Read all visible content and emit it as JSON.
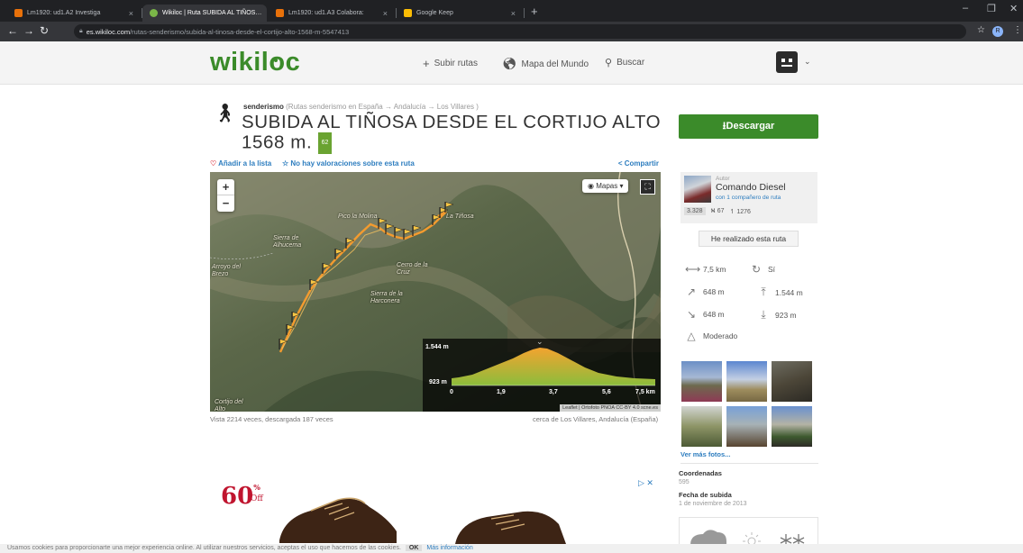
{
  "browser": {
    "tabs": [
      {
        "label": "Lm1920: ud1.A2 Investiga",
        "active": false
      },
      {
        "label": "Wikiloc | Ruta SUBIDA AL TIÑOS…",
        "active": true
      },
      {
        "label": "Lm1920: ud1.A3 Colabora:",
        "active": false
      },
      {
        "label": "Google Keep",
        "active": false
      }
    ],
    "new_tab": "+",
    "url_host": "es.wikiloc.com",
    "url_path": "/rutas-senderismo/subida-al-tinosa-desde-el-cortijo-alto-1568-m-5547413",
    "profile_initial": "R"
  },
  "header": {
    "logo": "wikiloc",
    "upload_label": "Subir rutas",
    "map_label": "Mapa del Mundo",
    "search_label": "Buscar"
  },
  "trail": {
    "activity": "senderismo",
    "breadcrumb": "(Rutas senderismo en España → Andalucía → Los Villares )",
    "title": "SUBIDA AL TIÑOSA DESDE EL CORTIJO ALTO 1568 m.",
    "score": "62",
    "add_list": "Añadir a la lista",
    "no_ratings": "No hay valoraciones sobre esta ruta",
    "share": "Compartir"
  },
  "map": {
    "zoom_in": "+",
    "zoom_out": "−",
    "layers_btn": "Mapas",
    "labels": {
      "sierra_alhucema": "Sierra de\nAlhucema",
      "cerro_cruz": "Cerro de la\nCruz",
      "sierra_harconera": "Sierra de la\nHarconera",
      "pico_molina": "Pico la Molina",
      "tinosa": "La Tiñosa",
      "cortijo": "Cortijo del\nAlto",
      "left_edge": "Arroyo del\nBrezo"
    },
    "elevation": {
      "max_label": "1.544 m",
      "min_label": "923 m",
      "x_ticks": [
        "0",
        "1,9",
        "3,7",
        "5,6",
        "7,5 km"
      ]
    },
    "attribution": "Leaflet | Ortofoto PNOA CC-BY 4.0 scne.es",
    "views_text": "Vista 2214 veces, descargada 187 veces",
    "near_text": "cerca de Los Villares, Andalucía (España)"
  },
  "ad": {
    "discount": "60",
    "percent": "%",
    "off": "Off"
  },
  "sidebar": {
    "download": "Descargar",
    "author_label": "Autor",
    "author_name": "Comando Diesel",
    "author_companions": "con 1 compañero de ruta",
    "author_points": "3.328",
    "author_trails": "67",
    "author_followers": "1276",
    "done_button": "He realizado esta ruta",
    "distance": "7,5 km",
    "loop": "Sí",
    "ascent": "648 m",
    "max_alt": "1.544 m",
    "descent": "648 m",
    "min_alt": "923 m",
    "difficulty": "Moderado",
    "more_photos": "Ver más fotos...",
    "coords_label": "Coordenadas",
    "coords_value": "595",
    "date_label": "Fecha de subida",
    "date_value": "1 de noviembre de 2013"
  },
  "cookies": {
    "text": "Usamos cookies para proporcionarte una mejor experiencia online. Al utilizar nuestros servicios, aceptas el uso que hacemos de las cookies.",
    "ok": "OK",
    "more": "Más información"
  },
  "colors": {
    "brand_green": "#3b8b2a",
    "link_blue": "#2d7dbf",
    "track_orange": "#f39b2f"
  }
}
